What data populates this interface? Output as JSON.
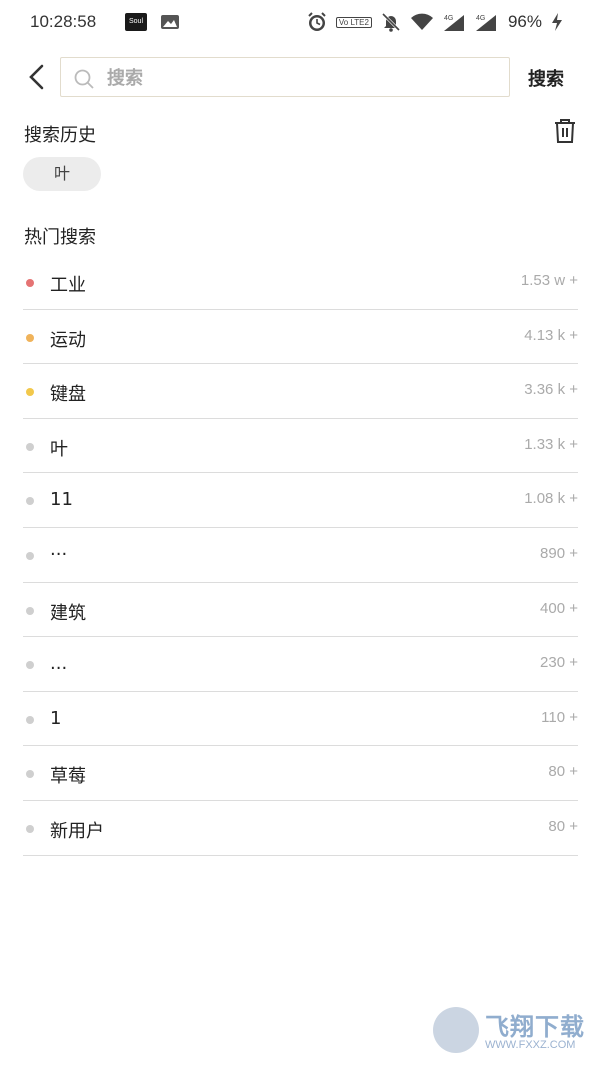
{
  "status_bar": {
    "time": "10:28:58",
    "soul_app_label": "Soul",
    "volte_label": "Vo LTE2",
    "signal_label_1": "4G",
    "signal_label_2": "4G",
    "battery": "96%"
  },
  "search": {
    "placeholder": "搜索",
    "value": "",
    "button_label": "搜索"
  },
  "history": {
    "title": "搜索历史",
    "chips": [
      "叶"
    ]
  },
  "hot": {
    "title": "热门搜索",
    "items": [
      {
        "label": "工业",
        "count": "1.53 w +",
        "dot_color": "#e57373"
      },
      {
        "label": "运动",
        "count": "4.13 k +",
        "dot_color": "#f0b35a"
      },
      {
        "label": "键盘",
        "count": "3.36 k +",
        "dot_color": "#f2c84b"
      },
      {
        "label": "叶",
        "count": "1.33 k +",
        "dot_color": "#cfcfcf"
      },
      {
        "label": "11",
        "count": "1.08 k +",
        "dot_color": "#cfcfcf"
      },
      {
        "label": "···",
        "count": "890 +",
        "dot_color": "#cfcfcf"
      },
      {
        "label": "建筑",
        "count": "400 +",
        "dot_color": "#cfcfcf"
      },
      {
        "label": "...",
        "count": "230 +",
        "dot_color": "#cfcfcf"
      },
      {
        "label": "1",
        "count": "110 +",
        "dot_color": "#cfcfcf"
      },
      {
        "label": "草莓",
        "count": "80 +",
        "dot_color": "#cfcfcf"
      },
      {
        "label": "新用户",
        "count": "80 +",
        "dot_color": "#cfcfcf"
      }
    ]
  },
  "watermark": {
    "title": "飞翔下载",
    "url": "WWW.FXXZ.COM"
  }
}
